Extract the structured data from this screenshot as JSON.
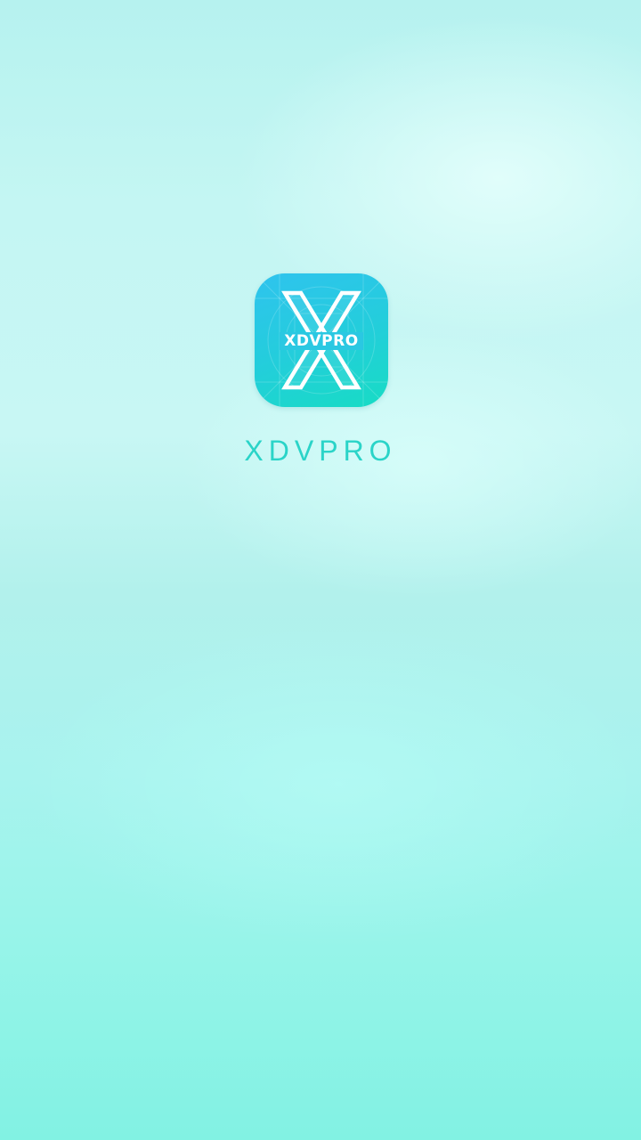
{
  "app": {
    "name": "XDVPRO",
    "icon": {
      "name": "xdvpro-logo-icon",
      "wordmark": "XDVPRO",
      "colors": {
        "top": "#2fc3ee",
        "bottom": "#17dcc4",
        "mark": "#ffffff"
      }
    }
  },
  "theme": {
    "text_color": "#2ad4c8",
    "background_top": "#b6f2ef",
    "background_bottom": "#82f2e3"
  }
}
